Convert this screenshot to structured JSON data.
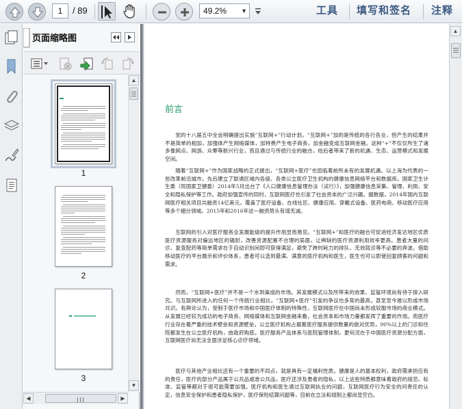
{
  "toolbar": {
    "page_current": "1",
    "page_total": "/ 89",
    "zoom": "49.2%",
    "links": [
      "工具",
      "填写和签名",
      "注释"
    ]
  },
  "panel": {
    "title": "页面缩略图",
    "thumbnails": [
      {
        "label": "1",
        "selected": true
      },
      {
        "label": "2",
        "selected": false
      },
      {
        "label": "3",
        "selected": false
      }
    ]
  },
  "document": {
    "heading": "前言",
    "paragraphs": [
      "党的十八届五中全会明确提出实施“互联网+”行动计划。“互联网+”加的是传统的各行各业，但产生的结果并不是简单的相加，加强体产生网络媒体，加特费产生电子商务，加金融变成互联网金融。这种“+”不仅仅所生了诸多像网点、网游、众筹等新兴行业，而且通过与传统行业的融合，给后者带来了新的机遇、生态、运营模式和发展空间。",
      "随着“互联网+”作为国家战略的正式提出，“互联网+医疗”也因临着前所未有的发展机遇。以上海为代表的一些改革前沿城市，先后建立了联通区域内各级、各类公立医疗卫生机构的健康信息网络平台和数据库。国家卫生计生委（现国家卫健委）2014年5月出台了《人口健康信息管理办法（试行）》，加强健康信息采集、管理、利用、安全和隐私保护等工作。政府加强宣传的同时，互联网医疗也引发了社会资本的广泛兴趣。据数据，2014年国内互联网医疗相关项目共融资14亿美元，覆盖了医疗设备、在线社区、健康应用、穿戴式设备、医药电商、移动医疗应用等多个细分领域。2015年和2016年这一融资势头有增无减。",
      "互联网的引入对医疗服务业发展能级的提升作用显而易见。“互联网+”和医疗的融合可促进经济发达地区优质医疗资源服务对偏远地区的辐射，改善资源配置不合理的局面，让稀缺的医疗资源利用效率更高。患者大量的问诊、复查配药等简单需求在于自动识别间即可获得满足，避免了跨时耗力的排队、无效就诊等不必要的奔波。借助移动医疗的平台展示和评价体系，患者可以选到最满、满意的医疗机构和医生，医生也可以即使回复顾客的问题和需求。",
      "然而，“互联网+医疗”并不是一个水到渠成的市场。其发展模式以及所带来的效果、监管环境尚有待于探入研究。与互联网所进入的任何一个传统行业相比，“互联网+医疗”引发的争议也多育的最高，甚至至今难以形成市场共识。有舆论认为，受制于医疗市场和中国医疗体制的特殊性，互联网医疗在中国尚未形成较服市场的商业模式。从发展已经较为成功的电子商务、网络媒体和互联网金融来看，社会资本和市场力量都发挥了重要的作用。而医疗行业存在着严重的技术壁垒和资源壁垒，公立医疗机构占据着医疗服务提供数量的绝对优势，90%以上的门诊和住院都发生在公立医疗机构，由政府购底，医疗服务产品体系与医院管理体制，更何况在于中国医疗资源分配方面，互联网医疗尚无法全面涉足核心诊疗领域。",
      "医疗与其他产业相比还有一个重要的不同点，就是具有一定福利性质。健康是人的基本权利，政府需承担应有的责任，医疗的部分产品属于公共品或准公共品，医疗还涉及患者的隐私，以上这些特质都意味着政府的规范、标准、监管等都对于很可能需要加强。医疗机构和医生通过互联网执业的问题，互联网医疗行为安全的问责任的认定，信息安全保护和患者隐私保护，医疗保险结算问题等，目前在立法和规制上都尚显空白。"
    ]
  }
}
